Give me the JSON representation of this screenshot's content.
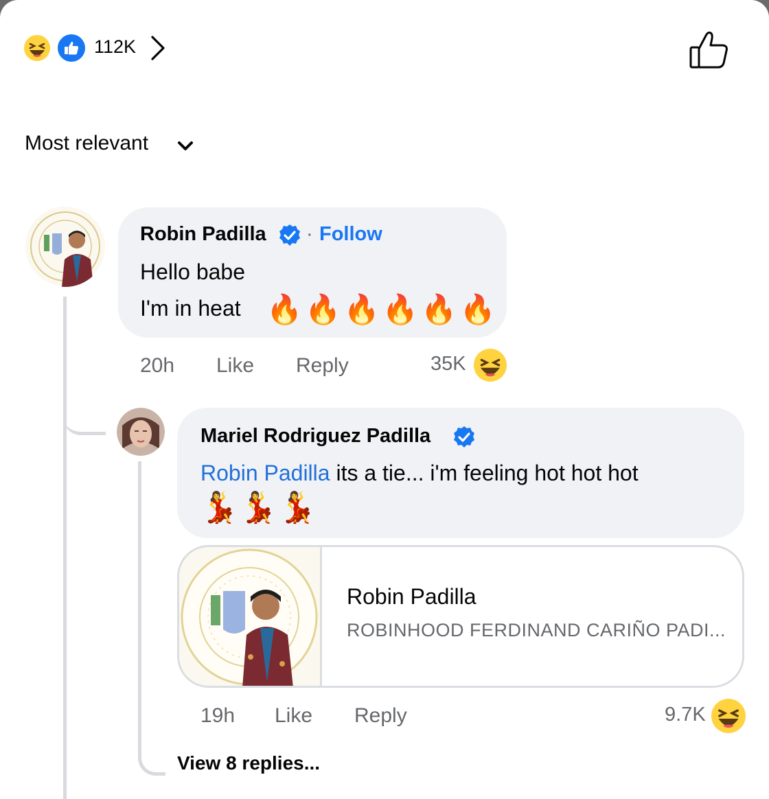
{
  "header": {
    "reaction_count": "112K",
    "reaction_icons": [
      "laughing-face-icon",
      "like-icon"
    ],
    "chevron_icon": "chevron-right-icon",
    "like_button_icon": "thumbs-up-outline-icon"
  },
  "sort": {
    "label": "Most relevant",
    "icon": "chevron-down-icon"
  },
  "comments": [
    {
      "author": "Robin Padilla",
      "verified": true,
      "follow_label": "Follow",
      "separator": "·",
      "lines": [
        "Hello babe",
        "I'm in heat"
      ],
      "emoji_line": [
        "🔥",
        "🔥",
        "🔥",
        "🔥",
        "🔥",
        "🔥"
      ],
      "time": "20h",
      "like_label": "Like",
      "reply_label": "Reply",
      "reaction_count": "35K",
      "reaction_icon": "laughing-face-icon"
    },
    {
      "author": "Mariel Rodriguez Padilla",
      "verified": true,
      "mention": "Robin Padilla",
      "text": " its a tie... i'm feeling hot hot hot",
      "emoji_line": [
        "💃",
        "💃",
        "💃"
      ],
      "link_card": {
        "title": "Robin Padilla",
        "subtitle": "ROBINHOOD FERDINAND CARIÑO PADI..."
      },
      "time": "19h",
      "like_label": "Like",
      "reply_label": "Reply",
      "reaction_count": "9.7K",
      "reaction_icon": "laughing-face-icon"
    }
  ],
  "view_replies_label": "View 8 replies...",
  "colors": {
    "accent_blue": "#1877f2",
    "bubble_gray": "#f0f2f5",
    "meta_gray": "#65676b",
    "reaction_yellow": "#ffd23f"
  }
}
